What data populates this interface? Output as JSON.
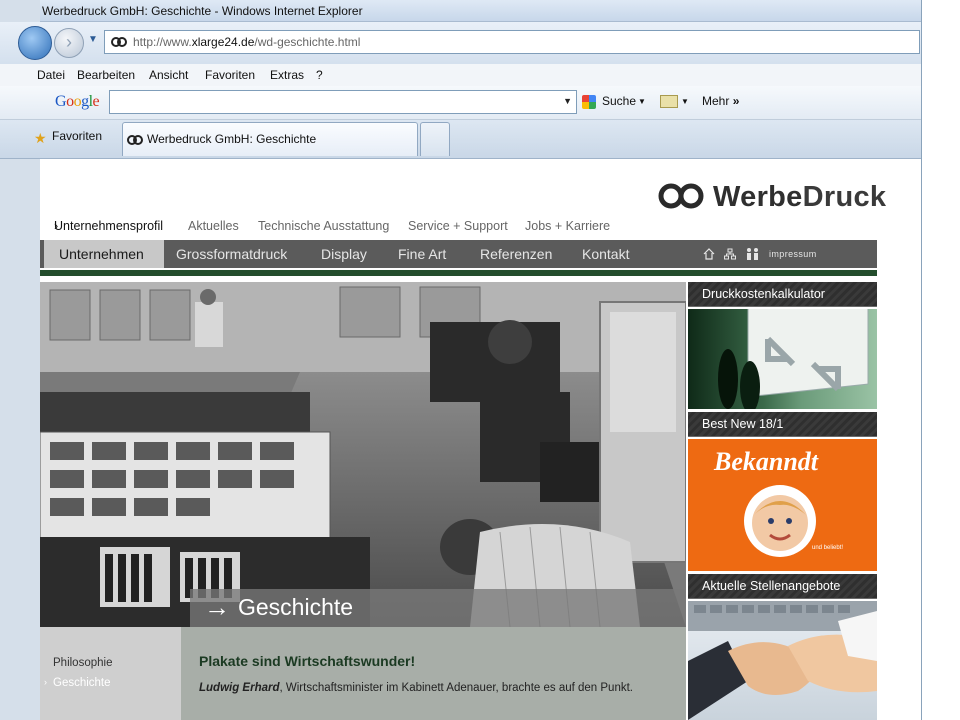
{
  "window": {
    "title": "Werbedruck GmbH: Geschichte - Windows Internet Explorer"
  },
  "address": {
    "url_prefix": "http://www.",
    "url_domain": "xlarge24.de",
    "url_path": "/wd-geschichte.html"
  },
  "menu": {
    "items": [
      "Datei",
      "Bearbeiten",
      "Ansicht",
      "Favoriten",
      "Extras",
      "?"
    ]
  },
  "google_toolbar": {
    "logo": "Google",
    "search_label": "Suche",
    "more_label": "Mehr",
    "more_glyph": "»"
  },
  "tabs": {
    "favorites_label": "Favoriten",
    "active_tab": "Werbedruck GmbH: Geschichte"
  },
  "site": {
    "logo_word_1": "Werbe",
    "logo_word_2": "Druck",
    "subnav": {
      "active_prefix": "›",
      "items": [
        "Unternehmensprofil",
        "Aktuelles",
        "Technische Ausstattung",
        "Service + Support",
        "Jobs + Karriere"
      ]
    },
    "mainnav": {
      "items": [
        "Unternehmen",
        "Grossformatdruck",
        "Display",
        "Fine Art",
        "Referenzen",
        "Kontakt"
      ],
      "impressum": "impressum"
    },
    "hero": {
      "arrow": "→",
      "caption": "Geschichte"
    },
    "sidemenu": {
      "items": [
        "Philosophie",
        "Geschichte"
      ],
      "active_bullet": "›"
    },
    "article": {
      "headline": "Plakate sind Wirtschaftswunder!",
      "author": "Ludwig Erhard",
      "text": ", Wirtschaftsminister im Kabinett Adenauer, brachte es auf den Punkt."
    },
    "rightcol": {
      "box1": "Druckkostenkalkulator",
      "box2": "Best New 18/1",
      "box3": "Aktuelle Stellenangebote",
      "ad_brand": "Bekanndt",
      "ad_tagline": "und beliebt!"
    }
  },
  "colors": {
    "nav_bg": "#5b5b5b",
    "accent_green": "#234d2c",
    "ad_orange": "#ee6a12"
  }
}
